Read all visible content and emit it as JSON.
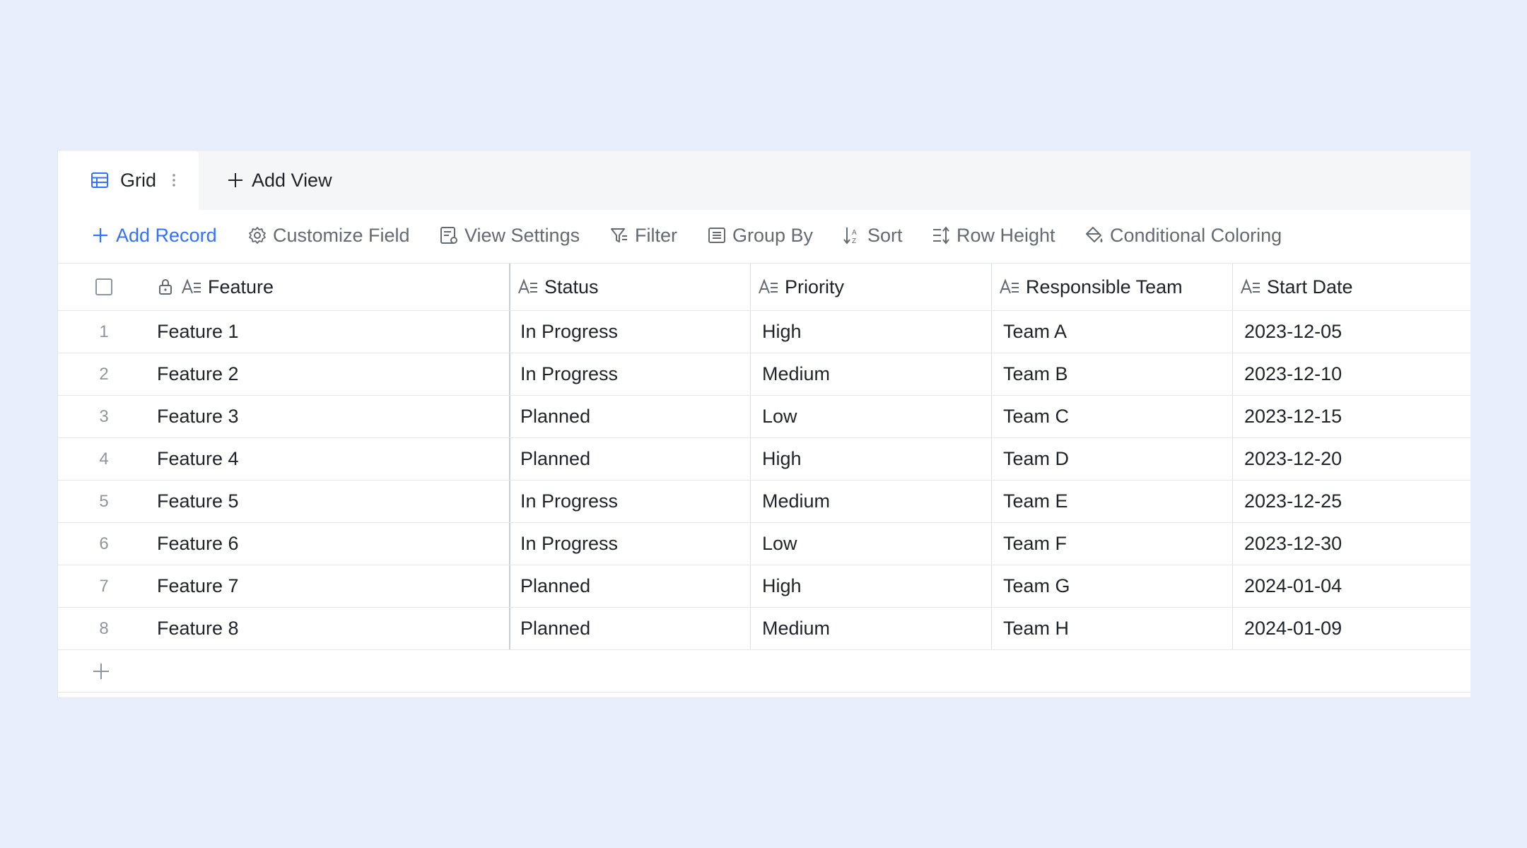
{
  "colors": {
    "background": "#e8eefc",
    "accent": "#3370ff",
    "toolbar_text": "#646a73"
  },
  "tabs": {
    "active": {
      "label": "Grid",
      "icon": "grid-icon"
    },
    "add_view_label": "Add View"
  },
  "toolbar": {
    "add_record": "Add Record",
    "customize_field": "Customize Field",
    "view_settings": "View Settings",
    "filter": "Filter",
    "group_by": "Group By",
    "sort": "Sort",
    "row_height": "Row Height",
    "conditional_coloring": "Conditional Coloring"
  },
  "table": {
    "columns": [
      "Feature",
      "Status",
      "Priority",
      "Responsible Team",
      "Start Date"
    ],
    "rows": [
      {
        "num": "1",
        "feature": "Feature 1",
        "status": "In Progress",
        "priority": "High",
        "team": "Team A",
        "date": "2023-12-05"
      },
      {
        "num": "2",
        "feature": "Feature 2",
        "status": "In Progress",
        "priority": "Medium",
        "team": "Team B",
        "date": "2023-12-10"
      },
      {
        "num": "3",
        "feature": "Feature 3",
        "status": "Planned",
        "priority": "Low",
        "team": "Team C",
        "date": "2023-12-15"
      },
      {
        "num": "4",
        "feature": "Feature 4",
        "status": "Planned",
        "priority": "High",
        "team": "Team D",
        "date": "2023-12-20"
      },
      {
        "num": "5",
        "feature": "Feature 5",
        "status": "In Progress",
        "priority": "Medium",
        "team": "Team E",
        "date": "2023-12-25"
      },
      {
        "num": "6",
        "feature": "Feature 6",
        "status": "In Progress",
        "priority": "Low",
        "team": "Team F",
        "date": "2023-12-30"
      },
      {
        "num": "7",
        "feature": "Feature 7",
        "status": "Planned",
        "priority": "High",
        "team": "Team G",
        "date": "2024-01-04"
      },
      {
        "num": "8",
        "feature": "Feature 8",
        "status": "Planned",
        "priority": "Medium",
        "team": "Team H",
        "date": "2024-01-09"
      }
    ]
  }
}
